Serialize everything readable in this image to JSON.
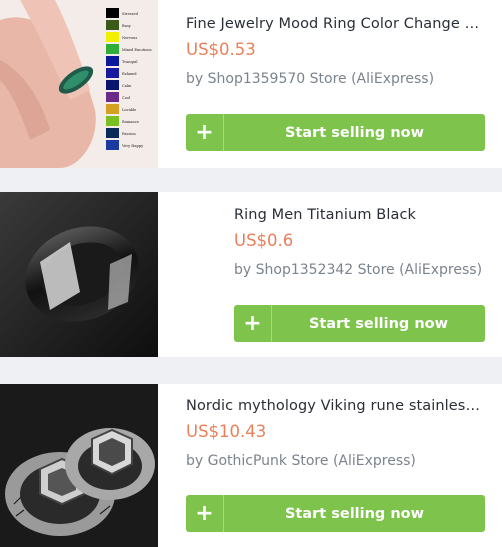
{
  "products": [
    {
      "title": "Fine Jewelry Mood Ring Color Change E...",
      "price": "US$0.53",
      "store": "by Shop1359570 Store (AliExpress)",
      "button_label": "Start selling now",
      "image_icon": "mood-ring-hand-image",
      "mood_chart_labels": [
        "Stressed",
        "Busy",
        "Nervous",
        "Mixed Emotions",
        "Tranquil",
        "Relaxed",
        "Calm",
        "Cool",
        "Lovable",
        "Romance",
        "Passion",
        "Very Happy"
      ]
    },
    {
      "title": "Ring Men Titanium Black",
      "price": "US$0.6",
      "store": "by Shop1352342 Store (AliExpress)",
      "button_label": "Start selling now",
      "image_icon": "black-titanium-ring-image"
    },
    {
      "title": "Nordic mythology Viking rune stainless ...",
      "price": "US$10.43",
      "store": "by GothicPunk Store (AliExpress)",
      "button_label": "Start selling now",
      "image_icon": "viking-rune-rings-image"
    }
  ],
  "colors": {
    "accent_green": "#7dc34c",
    "price_orange": "#e9805a",
    "background": "#eef0f3"
  },
  "plus_icon": "+"
}
